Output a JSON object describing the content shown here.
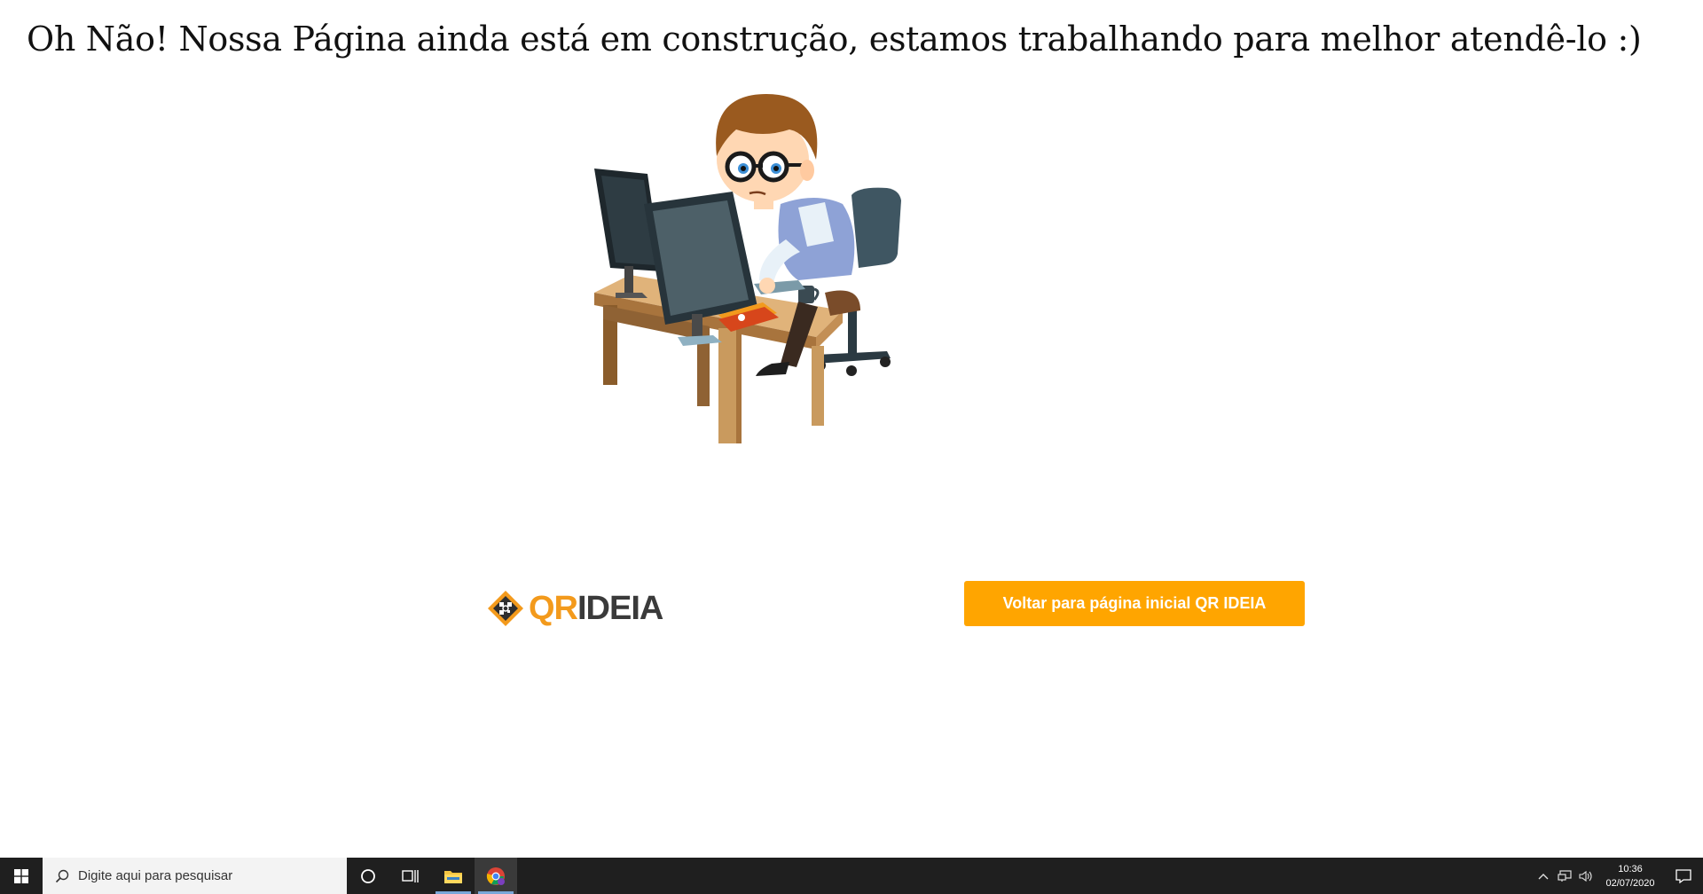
{
  "page": {
    "headline": "Oh Não! Nossa Página ainda está em construção, estamos trabalhando para melhor atendê-lo :)",
    "illustration_icon": "developer-at-computer-illustration",
    "brand": {
      "name_part1": "QR",
      "name_part2": "IDEIA",
      "accent_color": "#f39a1c",
      "dark_color": "#3a3a3a"
    },
    "home_button_label": "Voltar para página inicial QR IDEIA",
    "home_button_color": "#ffa500"
  },
  "taskbar": {
    "start_icon": "windows-start-icon",
    "search_placeholder": "Digite aqui para pesquisar",
    "apps": [
      {
        "name": "cortana",
        "icon": "circle-icon"
      },
      {
        "name": "task-view",
        "icon": "task-view-icon"
      },
      {
        "name": "file-explorer",
        "icon": "folder-icon",
        "open": true
      },
      {
        "name": "chrome",
        "icon": "chrome-icon",
        "active": true
      }
    ],
    "tray": {
      "icons": [
        "chevron-up-icon",
        "network-icon",
        "volume-icon"
      ],
      "time": "10:36",
      "date": "02/07/2020",
      "notification_icon": "notification-icon"
    }
  }
}
